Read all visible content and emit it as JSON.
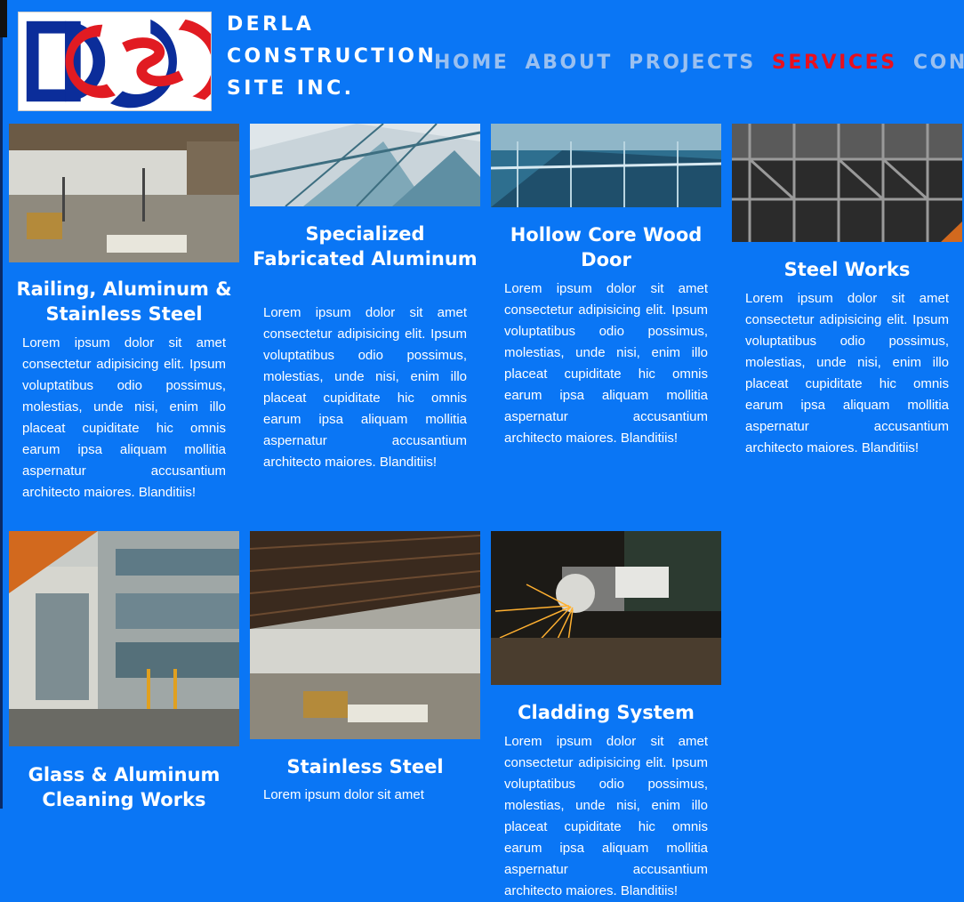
{
  "brand": {
    "line1": "DERLA",
    "line2": "CONSTRUCTION",
    "line3": "SITE INC.",
    "logo_text": "DCSI",
    "logo_colors": {
      "blue": "#0b2d9a",
      "red": "#e11b22"
    }
  },
  "nav": {
    "items": [
      "HOME",
      "ABOUT",
      "PROJECTS",
      "SERVICES",
      "CONT"
    ],
    "active": "SERVICES",
    "colors": {
      "normal": "#9ac0f0",
      "active": "#e8101e"
    }
  },
  "services": [
    {
      "title": "Railing, Aluminum & Stainless Steel",
      "image_icon": "building-interior-photo",
      "description": "Lorem ipsum dolor sit amet consectetur adipisicing elit. Ipsum voluptatibus odio possimus, molestias, unde nisi, enim illo placeat cupiditate hic omnis earum ipsa aliquam mollitia aspernatur accusantium architecto maiores. Blanditiis!"
    },
    {
      "title": "Specialized Fabricated Aluminum",
      "image_icon": "glass-roof-photo",
      "description": "Lorem ipsum dolor sit amet consectetur adipisicing elit. Ipsum voluptatibus odio possimus, molestias, unde nisi, enim illo placeat cupiditate hic omnis earum ipsa aliquam mollitia aspernatur accusantium architecto maiores. Blanditiis!"
    },
    {
      "title": "Hollow Core Wood Door",
      "image_icon": "glass-railing-photo",
      "description": "Lorem ipsum dolor sit amet consectetur adipisicing elit. Ipsum voluptatibus odio possimus, molestias, unde nisi, enim illo placeat cupiditate hic omnis earum ipsa aliquam mollitia aspernatur accusantium architecto maiores. Blanditiis!"
    },
    {
      "title": "Steel Works",
      "image_icon": "steel-frame-photo",
      "description": "Lorem ipsum dolor sit amet consectetur adipisicing elit. Ipsum voluptatibus odio possimus, molestias, unde nisi, enim illo placeat cupiditate hic omnis earum ipsa aliquam mollitia aspernatur accusantium architecto maiores. Blanditiis!"
    },
    {
      "title": "Glass & Aluminum Cleaning Works",
      "image_icon": "building-facade-photo",
      "description": ""
    },
    {
      "title": "Stainless Steel",
      "image_icon": "ceiling-interior-photo",
      "description": "Lorem ipsum dolor sit amet"
    },
    {
      "title": "Cladding System",
      "image_icon": "grinder-sparks-photo",
      "description": "Lorem ipsum dolor sit amet consectetur adipisicing elit. Ipsum voluptatibus odio possimus, molestias, unde nisi, enim illo placeat cupiditate hic omnis earum ipsa aliquam mollitia aspernatur accusantium architecto maiores. Blanditiis!"
    }
  ]
}
